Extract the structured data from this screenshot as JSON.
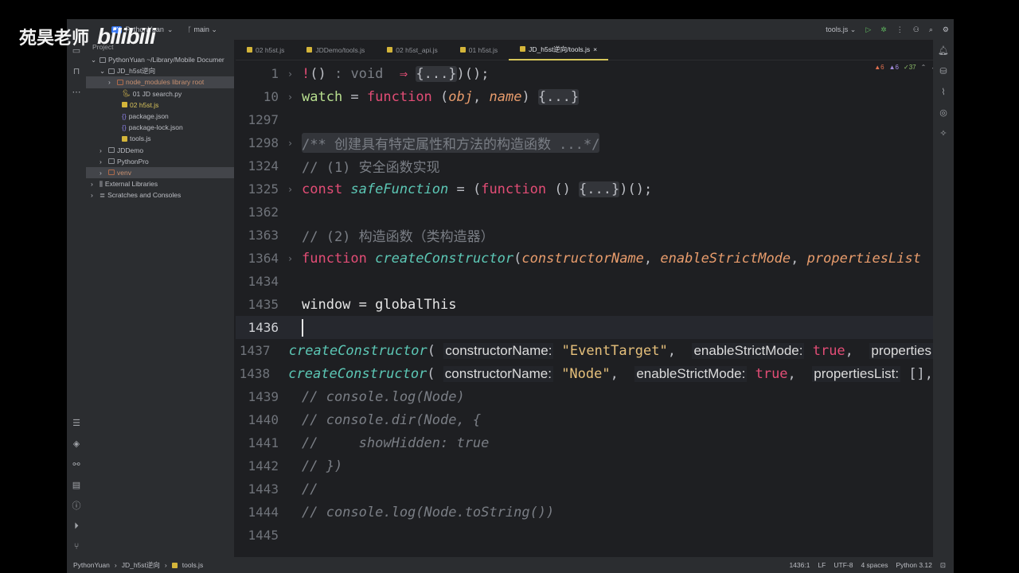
{
  "watermark": {
    "name": "苑昊老师",
    "brand": "bilibili"
  },
  "titlebar": {
    "project_badge": "PY",
    "project": "PythonYuan",
    "branch": "main",
    "run_config": "tools.js"
  },
  "sidebar": {
    "header": "Project",
    "tree": [
      {
        "label": "PythonYuan ~/Library/Mobile Documer",
        "depth": 0,
        "type": "folder",
        "open": true
      },
      {
        "label": "JD_h5st逆向",
        "depth": 1,
        "type": "folder",
        "open": true
      },
      {
        "label": "node_modules  library root",
        "depth": 2,
        "type": "excluded",
        "selected": true
      },
      {
        "label": "01 JD search.py",
        "depth": 2,
        "type": "py"
      },
      {
        "label": "02 h5st.js",
        "depth": 2,
        "type": "js",
        "highlight": true
      },
      {
        "label": "package.json",
        "depth": 2,
        "type": "json"
      },
      {
        "label": "package-lock.json",
        "depth": 2,
        "type": "json"
      },
      {
        "label": "tools.js",
        "depth": 2,
        "type": "js"
      },
      {
        "label": "JDDemo",
        "depth": 1,
        "type": "folder"
      },
      {
        "label": "PythonPro",
        "depth": 1,
        "type": "folder"
      },
      {
        "label": "venv",
        "depth": 1,
        "type": "excluded",
        "selected": true
      },
      {
        "label": "External Libraries",
        "depth": 0,
        "type": "lib"
      },
      {
        "label": "Scratches and Consoles",
        "depth": 0,
        "type": "scratch"
      }
    ]
  },
  "tabs": [
    {
      "label": "02 h5st.js"
    },
    {
      "label": "JDDemo/tools.js"
    },
    {
      "label": "02 h5st_api.js"
    },
    {
      "label": "01 h5st.js"
    },
    {
      "label": "JD_h5st逆向/tools.js",
      "active": true
    }
  ],
  "inspections": {
    "errors": "6",
    "warnings": "6",
    "ok": "37"
  },
  "code": [
    {
      "n": "1",
      "fold": true,
      "t": [
        [
          "kw",
          "!"
        ],
        [
          "pl",
          "()"
        ],
        [
          "cm",
          " : void  "
        ],
        [
          "kw",
          "⇒"
        ],
        [
          "pl",
          " "
        ],
        [
          "fb",
          "{...}"
        ],
        [
          "pl",
          ")();"
        ]
      ]
    },
    {
      "n": "10",
      "fold": true,
      "t": [
        [
          "gr",
          "watch"
        ],
        [
          "pl",
          " = "
        ],
        [
          "kw",
          "function"
        ],
        [
          "pl",
          " ("
        ],
        [
          "pa",
          "obj"
        ],
        [
          "pl",
          ", "
        ],
        [
          "pa",
          "name"
        ],
        [
          "pl",
          ") "
        ],
        [
          "fb",
          "{...}"
        ]
      ]
    },
    {
      "n": "1297",
      "t": []
    },
    {
      "n": "1298",
      "fold": true,
      "t": [
        [
          "fbc",
          "/** 创建具有特定属性和方法的构造函数 ...*/"
        ]
      ]
    },
    {
      "n": "1324",
      "t": [
        [
          "cm",
          "// (1) 安全函数实现"
        ]
      ]
    },
    {
      "n": "1325",
      "fold": true,
      "t": [
        [
          "kw",
          "const "
        ],
        [
          "fn",
          "safeFunction"
        ],
        [
          "pl",
          " = ("
        ],
        [
          "kw",
          "function"
        ],
        [
          "pl",
          " () "
        ],
        [
          "fb",
          "{...}"
        ],
        [
          "pl",
          ")();"
        ]
      ]
    },
    {
      "n": "1362",
      "t": []
    },
    {
      "n": "1363",
      "t": [
        [
          "cm",
          "// (2) 构造函数（类构造器）"
        ]
      ]
    },
    {
      "n": "1364",
      "fold": true,
      "t": [
        [
          "kw",
          "function "
        ],
        [
          "fn",
          "createConstructor"
        ],
        [
          "pl",
          "("
        ],
        [
          "pa",
          "constructorName"
        ],
        [
          "pl",
          ", "
        ],
        [
          "pa",
          "enableStrictMode"
        ],
        [
          "pl",
          ", "
        ],
        [
          "pa",
          "propertiesList"
        ]
      ]
    },
    {
      "n": "1434",
      "t": []
    },
    {
      "n": "1435",
      "t": [
        [
          "wh",
          "window = globalThis"
        ]
      ]
    },
    {
      "n": "1436",
      "cur": true,
      "t": [
        [
          "caret",
          ""
        ]
      ]
    },
    {
      "n": "1437",
      "t": [
        [
          "fn",
          "createConstructor"
        ],
        [
          "pl",
          "( "
        ],
        [
          "hint",
          "constructorName:"
        ],
        [
          "st",
          " \"EventTarget\""
        ],
        [
          "pl",
          ",  "
        ],
        [
          "hint",
          "enableStrictMode:"
        ],
        [
          "kw",
          " true"
        ],
        [
          "pl",
          ",  "
        ],
        [
          "hint",
          "properties"
        ]
      ]
    },
    {
      "n": "1438",
      "t": [
        [
          "fn",
          "createConstructor"
        ],
        [
          "pl",
          "( "
        ],
        [
          "hint",
          "constructorName:"
        ],
        [
          "st",
          " \"Node\""
        ],
        [
          "pl",
          ",  "
        ],
        [
          "hint",
          "enableStrictMode:"
        ],
        [
          "kw",
          " true"
        ],
        [
          "pl",
          ",  "
        ],
        [
          "hint",
          "propertiesList:"
        ],
        [
          "pl",
          " [],"
        ]
      ]
    },
    {
      "n": "1439",
      "t": [
        [
          "cmi",
          "// console.log(Node)"
        ]
      ]
    },
    {
      "n": "1440",
      "t": [
        [
          "cmi",
          "// console.dir(Node, {"
        ]
      ]
    },
    {
      "n": "1441",
      "t": [
        [
          "cmi",
          "//     showHidden: true"
        ]
      ]
    },
    {
      "n": "1442",
      "t": [
        [
          "cmi",
          "// })"
        ]
      ]
    },
    {
      "n": "1443",
      "t": [
        [
          "cmi",
          "//"
        ]
      ]
    },
    {
      "n": "1444",
      "t": [
        [
          "cmi",
          "// console.log(Node.toString())"
        ]
      ]
    },
    {
      "n": "1445",
      "t": []
    }
  ],
  "statusbar": {
    "breadcrumb": [
      "PythonYuan",
      "JD_h5st逆向",
      "tools.js"
    ],
    "position": "1436:1",
    "line_sep": "LF",
    "encoding": "UTF-8",
    "indent": "4 spaces",
    "interpreter": "Python 3.12"
  }
}
